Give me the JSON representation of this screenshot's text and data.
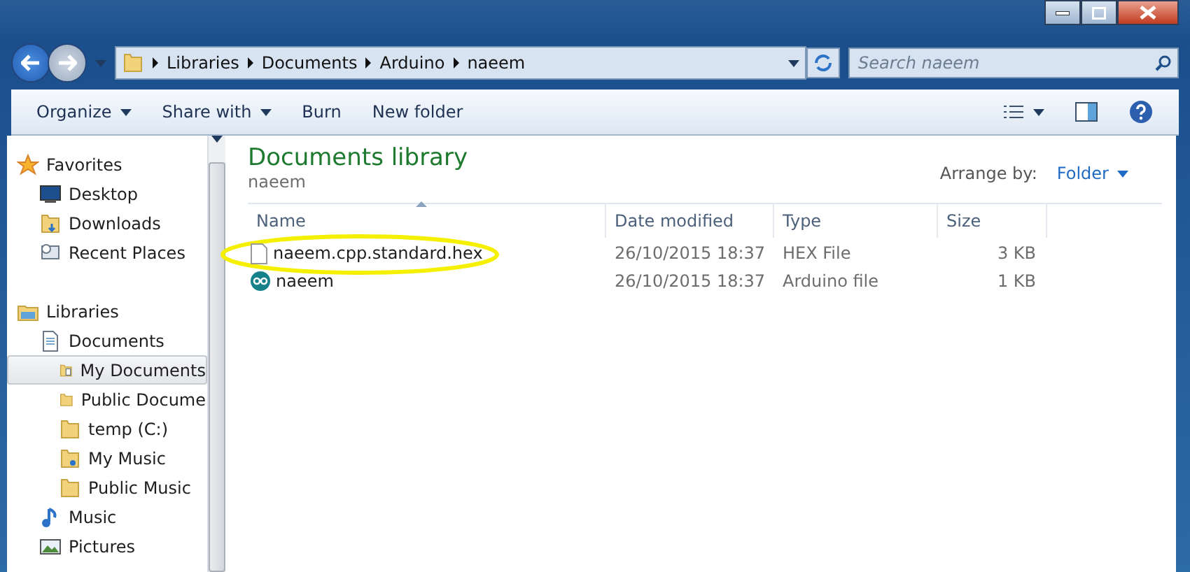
{
  "address_bar": {
    "crumbs": [
      "Libraries",
      "Documents",
      "Arduino",
      "naeem"
    ]
  },
  "search": {
    "placeholder": "Search naeem"
  },
  "toolbar": {
    "buttons": [
      {
        "label": "Organize",
        "dropdown": true
      },
      {
        "label": "Share with",
        "dropdown": true
      },
      {
        "label": "Burn",
        "dropdown": false
      },
      {
        "label": "New folder",
        "dropdown": false
      }
    ]
  },
  "sidebar": {
    "groups": [
      {
        "label": "Favorites",
        "kind": "star",
        "children": [
          {
            "label": "Desktop",
            "kind": "desktop",
            "selected": false
          },
          {
            "label": "Downloads",
            "kind": "downloads",
            "selected": false
          },
          {
            "label": "Recent Places",
            "kind": "recent",
            "selected": false
          }
        ]
      },
      {
        "label": "Libraries",
        "kind": "library",
        "children": [
          {
            "label": "Documents",
            "kind": "document",
            "selected": false,
            "children": [
              {
                "label": "My Documents",
                "kind": "docfolder",
                "selected": true
              },
              {
                "label": "Public Docume",
                "kind": "folder",
                "selected": false
              },
              {
                "label": "temp (C:)",
                "kind": "folder",
                "selected": false
              },
              {
                "label": "My Music",
                "kind": "musicfolder",
                "selected": false
              },
              {
                "label": "Public Music",
                "kind": "folder",
                "selected": false
              }
            ]
          },
          {
            "label": "Music",
            "kind": "music",
            "selected": false
          },
          {
            "label": "Pictures",
            "kind": "pictures",
            "selected": false
          }
        ]
      }
    ]
  },
  "library_header": {
    "title": "Documents library",
    "subtitle": "naeem",
    "arrange_label": "Arrange by:",
    "arrange_value": "Folder"
  },
  "table": {
    "columns": [
      "Name",
      "Date modified",
      "Type",
      "Size"
    ],
    "rows": [
      {
        "kind": "hex",
        "name": "naeem.cpp.standard.hex",
        "date": "26/10/2015 18:37",
        "type": "HEX File",
        "size": "3 KB",
        "circled": true
      },
      {
        "kind": "arduino",
        "name": "naeem",
        "date": "26/10/2015 18:37",
        "type": "Arduino file",
        "size": "1 KB",
        "circled": false
      }
    ]
  }
}
